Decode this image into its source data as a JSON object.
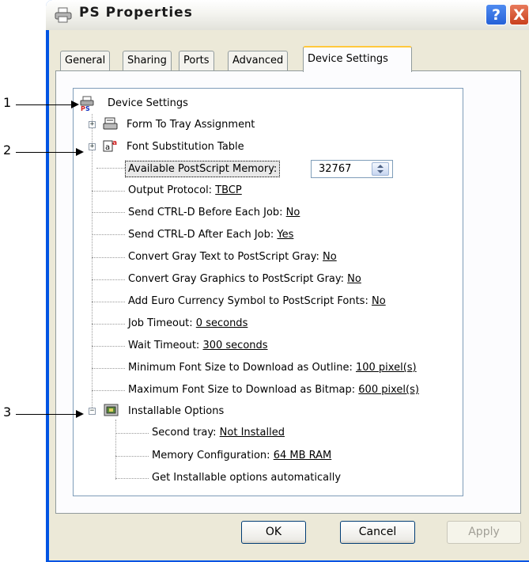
{
  "window": {
    "title": "PS Properties",
    "help_glyph": "?",
    "close_glyph": "X",
    "icon": "printer-icon"
  },
  "tabs": [
    "General",
    "Sharing",
    "Ports",
    "Advanced",
    "Device Settings"
  ],
  "active_tab": "Device Settings",
  "callouts": [
    "1",
    "2",
    "3"
  ],
  "tree": {
    "root": "Device Settings",
    "form_to_tray": "Form To Tray Assignment",
    "font_sub": "Font Substitution Table",
    "memory": {
      "label": "Available PostScript Memory:",
      "value": "32767"
    },
    "settings": [
      {
        "label": "Output Protocol: ",
        "value": "TBCP"
      },
      {
        "label": "Send CTRL-D Before Each Job: ",
        "value": "No"
      },
      {
        "label": "Send CTRL-D After Each Job: ",
        "value": "Yes"
      },
      {
        "label": "Convert Gray Text to PostScript Gray: ",
        "value": "No"
      },
      {
        "label": "Convert Gray Graphics to PostScript Gray: ",
        "value": "No"
      },
      {
        "label": "Add Euro Currency Symbol to PostScript Fonts: ",
        "value": "No"
      },
      {
        "label": "Job Timeout: ",
        "value": "0 seconds"
      },
      {
        "label": "Wait Timeout: ",
        "value": "300 seconds"
      },
      {
        "label": "Minimum Font Size to Download as Outline: ",
        "value": "100 pixel(s)"
      },
      {
        "label": "Maximum Font Size to Download as Bitmap: ",
        "value": "600 pixel(s)"
      }
    ],
    "installable": {
      "label": "Installable Options",
      "items": [
        {
          "label": "Second tray: ",
          "value": "Not Installed"
        },
        {
          "label": "Memory Configuration: ",
          "value": "64 MB RAM"
        },
        {
          "label": "Get Installable options automatically",
          "value": ""
        }
      ]
    }
  },
  "buttons": {
    "ok": "OK",
    "cancel": "Cancel",
    "apply": "Apply"
  },
  "colors": {
    "title_bar": "#ece9d8",
    "window_frame": "#0054e3",
    "tab_highlight": "#ffc83c",
    "selection_border": "#000000"
  }
}
